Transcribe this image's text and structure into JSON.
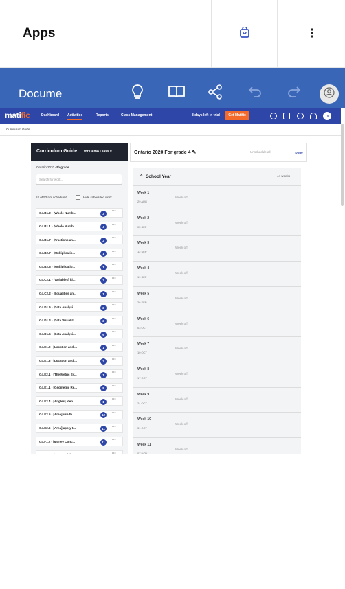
{
  "apps": {
    "title": "Apps"
  },
  "docs": {
    "title": "Docume"
  },
  "matific": {
    "logo_main": "mati",
    "logo_accent": "fic",
    "nav": [
      "Dashboard",
      "Activities",
      "Reports",
      "Class Management"
    ],
    "trial_text": "8 days left in trial",
    "get_button": "Get Matific",
    "user_initials": "TS",
    "breadcrumb": "Curriculum Guide",
    "left": {
      "title": "Curriculum Guide",
      "for_class": "for Demo Class",
      "curriculum": "Ontario 2020",
      "grade": "4th grade",
      "search_placeholder": "Search for work...",
      "count_text": "52 of 52 not scheduled",
      "hide_label": "Hide scheduled work",
      "items": [
        {
          "label": "G4.B1.2 - [Whole Numb...",
          "count": "2"
        },
        {
          "label": "G4.B1.1 - [Whole Numb...",
          "count": "4"
        },
        {
          "label": "G4.B1.7 - [Fractions an...",
          "count": "2"
        },
        {
          "label": "G4.B2.7 - [Multiplicatio...",
          "count": "1"
        },
        {
          "label": "G4.B2.6 - [Multiplicatio...",
          "count": "1"
        },
        {
          "label": "G4.C2.1 - [Variables] id...",
          "count": "3"
        },
        {
          "label": "G4.C2.2 - [Equalities an...",
          "count": "1"
        },
        {
          "label": "G4.D1.6 - [Data Analysi...",
          "count": "2"
        },
        {
          "label": "G4.D1.4 - [Data Visualiz...",
          "count": "2"
        },
        {
          "label": "G4.D1.5 - [Data Analysi...",
          "count": "6"
        },
        {
          "label": "G4.E1.2 - [Location and ...",
          "count": "1"
        },
        {
          "label": "G4.E1.3 - [Location and ...",
          "count": "2"
        },
        {
          "label": "G4.E2.1 - [The Metric Sy...",
          "count": "1"
        },
        {
          "label": "G4.E1.1 - [Geometric Re...",
          "count": "8"
        },
        {
          "label": "G4.E2.4 - [Angles] iden...",
          "count": "1"
        },
        {
          "label": "G4.E2.5 - [Area] use th...",
          "count": "12"
        },
        {
          "label": "G4.E2.6 - [Area] apply t...",
          "count": "11"
        },
        {
          "label": "G4.F1.2 - [Money Conc...",
          "count": "11"
        },
        {
          "label": "G4.C1.3 - [Patterns] det...",
          "count": ""
        }
      ]
    },
    "right": {
      "title": "Ontario 2020 For grade 4",
      "unschedule": "Unschedule all",
      "done": "Done",
      "school_year": "School Year",
      "weeks_count": "44 weeks",
      "week_off": "Week off",
      "weeks": [
        {
          "name": "Week 1",
          "date": "29 AUG"
        },
        {
          "name": "Week 2",
          "date": "05 SEP"
        },
        {
          "name": "Week 3",
          "date": "12 SEP"
        },
        {
          "name": "Week 4",
          "date": "19 SEP"
        },
        {
          "name": "Week 5",
          "date": "26 SEP"
        },
        {
          "name": "Week 6",
          "date": "03 OCT"
        },
        {
          "name": "Week 7",
          "date": "10 OCT"
        },
        {
          "name": "Week 8",
          "date": "17 OCT"
        },
        {
          "name": "Week 9",
          "date": "24 OCT"
        },
        {
          "name": "Week 10",
          "date": "31 OCT"
        },
        {
          "name": "Week 11",
          "date": "07 NOV"
        }
      ]
    }
  }
}
